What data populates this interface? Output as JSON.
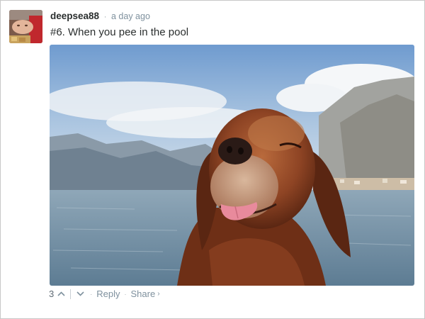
{
  "comment": {
    "author": "deepsea88",
    "separator": "·",
    "timestamp": "a day ago",
    "text": "#6. When you pee in the pool"
  },
  "footer": {
    "vote_count": "3",
    "upvote_icon": "chevron-up-icon",
    "downvote_icon": "chevron-down-icon",
    "dot": "·",
    "reply_label": "Reply",
    "share_label": "Share",
    "share_chevron": "›"
  },
  "colors": {
    "username": "#2a2e2e",
    "meta": "#7f919e",
    "border": "#c8c8c8"
  }
}
